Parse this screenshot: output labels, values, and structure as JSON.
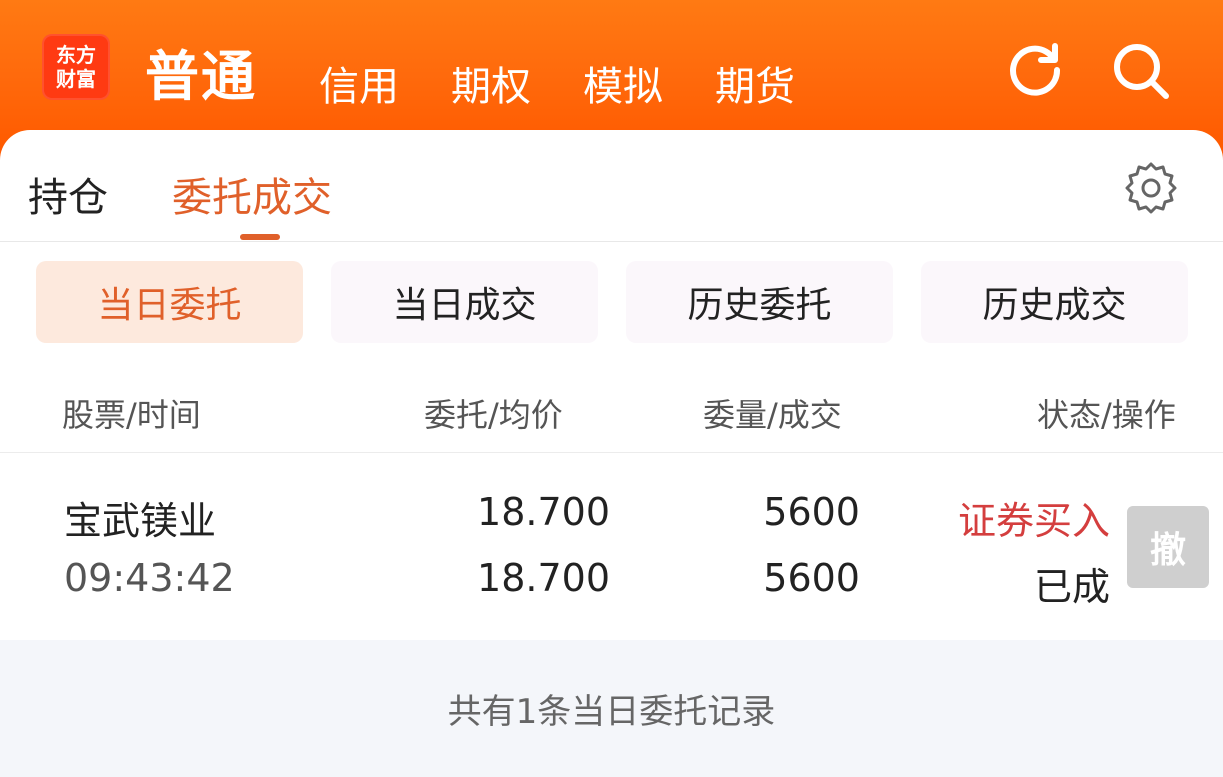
{
  "header": {
    "logo_lines": [
      "东方",
      "财富"
    ],
    "main_tab": "普通",
    "tabs": [
      "信用",
      "期权",
      "模拟",
      "期货"
    ],
    "icons": [
      "refresh-icon",
      "search-icon"
    ]
  },
  "position_tabs": {
    "items": [
      "持仓",
      "委托成交"
    ],
    "active": "委托成交"
  },
  "filters": [
    "当日委托",
    "当日成交",
    "历史委托",
    "历史成交"
  ],
  "filters_active": "当日委托",
  "table": {
    "headers": [
      "股票/时间",
      "委托/均价",
      "委量/成交",
      "状态/操作"
    ],
    "rows": [
      {
        "stock": "宝武镁业",
        "time": "09:43:42",
        "order_price": "18.700",
        "avg_price": "18.700",
        "order_qty": "5600",
        "deal_qty": "5600",
        "action": "证券买入",
        "status": "已成",
        "cancel_label": "撤"
      }
    ]
  },
  "footer_text": "共有1条当日委托记录",
  "colors": {
    "brand": "#ff6a0c",
    "accent": "#e0602a",
    "buy_red": "#d43e3e"
  }
}
